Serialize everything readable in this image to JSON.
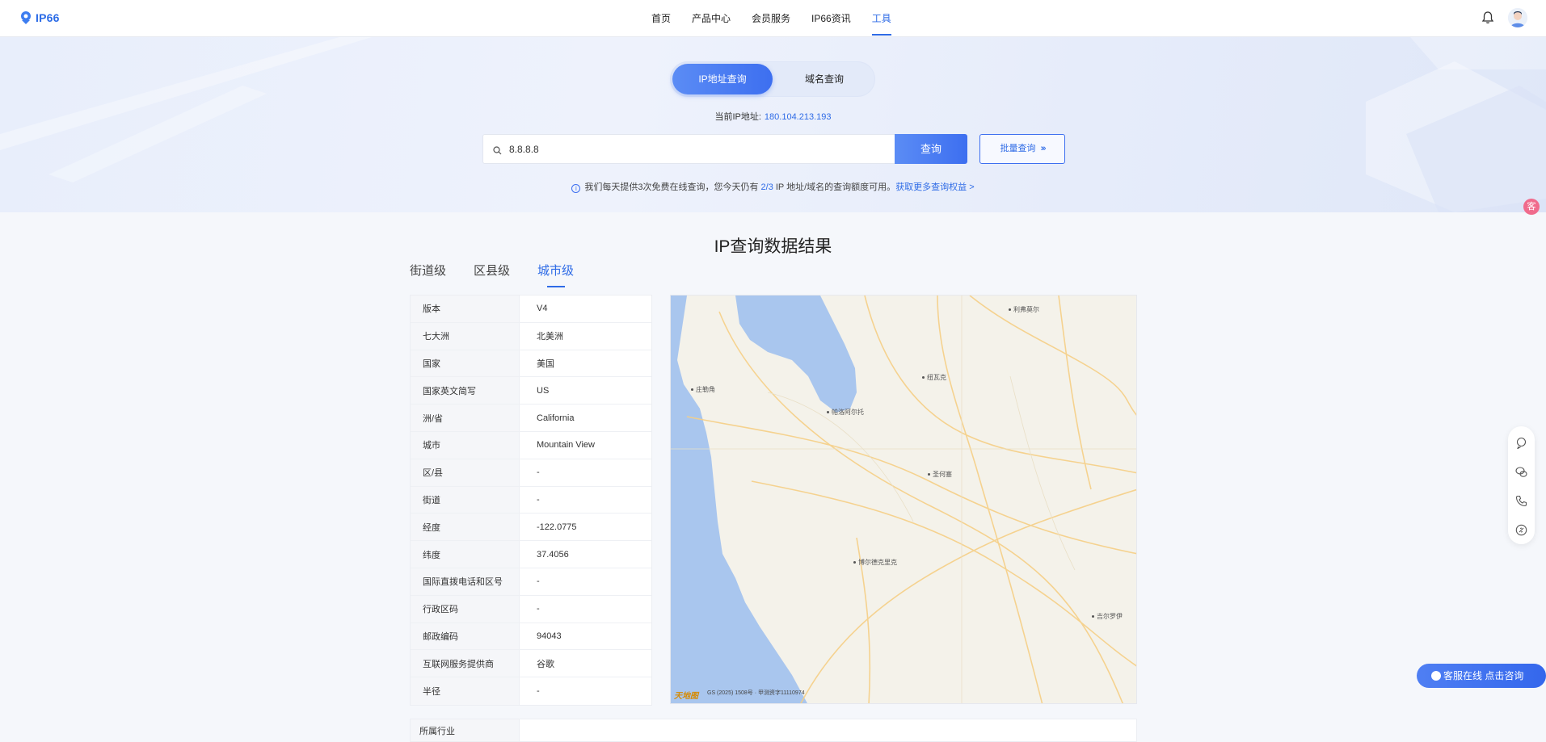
{
  "header": {
    "logo_text": "IP66",
    "nav": [
      {
        "label": "首页",
        "active": false
      },
      {
        "label": "产品中心",
        "active": false
      },
      {
        "label": "会员服务",
        "active": false
      },
      {
        "label": "IP66资讯",
        "active": false
      },
      {
        "label": "工具",
        "active": true
      }
    ],
    "icons": [
      "bell-icon",
      "avatar"
    ]
  },
  "hero": {
    "toggle": {
      "ip_label": "IP地址查询",
      "domain_label": "域名查询",
      "selected": "IP地址查询"
    },
    "current_ip_label": "当前IP地址:",
    "current_ip_value": "180.104.213.193",
    "search": {
      "value": "8.8.8.8"
    },
    "query_button": "查询",
    "batch_button": "批量查询",
    "batch_arrows": "›››",
    "notice": {
      "prefix": "我们每天提供3次免费在线查询，您今天仍有",
      "remaining": "2/3",
      "suffix": "IP 地址/域名的查询额度可用。",
      "more_link": "获取更多查询权益 >"
    }
  },
  "results": {
    "title": "IP查询数据结果",
    "tabs": [
      {
        "label": "街道级",
        "active": false
      },
      {
        "label": "区县级",
        "active": false
      },
      {
        "label": "城市级",
        "active": true
      }
    ],
    "rows": [
      {
        "key": "版本",
        "value": "V4"
      },
      {
        "key": "七大洲",
        "value": "北美洲"
      },
      {
        "key": "国家",
        "value": "美国"
      },
      {
        "key": "国家英文简写",
        "value": "US"
      },
      {
        "key": "洲/省",
        "value": "California"
      },
      {
        "key": "城市",
        "value": "Mountain View"
      },
      {
        "key": "区/县",
        "value": "-"
      },
      {
        "key": "街道",
        "value": "-"
      },
      {
        "key": "经度",
        "value": "-122.0775"
      },
      {
        "key": "纬度",
        "value": "37.4056"
      },
      {
        "key": "国际直拨电话和区号",
        "value": "-"
      },
      {
        "key": "行政区码",
        "value": "-"
      },
      {
        "key": "邮政编码",
        "value": "94043"
      },
      {
        "key": "互联网服务提供商",
        "value": "谷歌"
      },
      {
        "key": "半径",
        "value": "-"
      }
    ],
    "extra_row_key": "所属行业"
  },
  "map": {
    "labels": [
      "利弗莫尔",
      "纽瓦克",
      "庄勒角",
      "帕洛阿尔托",
      "圣何塞",
      "博尔德克里克",
      "吉尔罗伊"
    ],
    "copyright": "GS (2025) 1508号 · 甲测资字11110974",
    "logo": "天地图"
  },
  "side": {
    "badge": "客",
    "tools": [
      "chat-icon",
      "wechat-icon",
      "phone-icon",
      "link-icon"
    ],
    "cs_button": "客服在线 点击咨询"
  }
}
